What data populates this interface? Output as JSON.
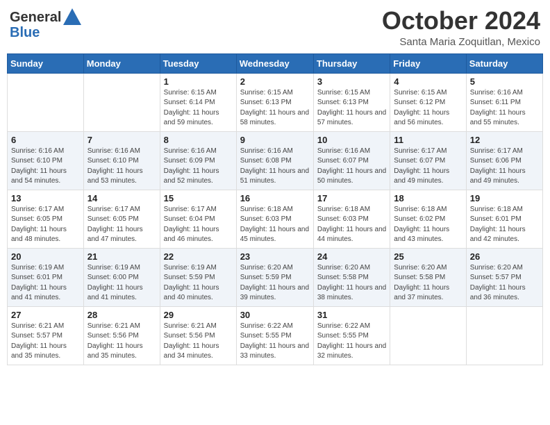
{
  "header": {
    "logo_general": "General",
    "logo_blue": "Blue",
    "month_title": "October 2024",
    "location": "Santa Maria Zoquitlan, Mexico"
  },
  "weekdays": [
    "Sunday",
    "Monday",
    "Tuesday",
    "Wednesday",
    "Thursday",
    "Friday",
    "Saturday"
  ],
  "weeks": [
    [
      {
        "day": "",
        "info": ""
      },
      {
        "day": "",
        "info": ""
      },
      {
        "day": "1",
        "info": "Sunrise: 6:15 AM\nSunset: 6:14 PM\nDaylight: 11 hours and 59 minutes."
      },
      {
        "day": "2",
        "info": "Sunrise: 6:15 AM\nSunset: 6:13 PM\nDaylight: 11 hours and 58 minutes."
      },
      {
        "day": "3",
        "info": "Sunrise: 6:15 AM\nSunset: 6:13 PM\nDaylight: 11 hours and 57 minutes."
      },
      {
        "day": "4",
        "info": "Sunrise: 6:15 AM\nSunset: 6:12 PM\nDaylight: 11 hours and 56 minutes."
      },
      {
        "day": "5",
        "info": "Sunrise: 6:16 AM\nSunset: 6:11 PM\nDaylight: 11 hours and 55 minutes."
      }
    ],
    [
      {
        "day": "6",
        "info": "Sunrise: 6:16 AM\nSunset: 6:10 PM\nDaylight: 11 hours and 54 minutes."
      },
      {
        "day": "7",
        "info": "Sunrise: 6:16 AM\nSunset: 6:10 PM\nDaylight: 11 hours and 53 minutes."
      },
      {
        "day": "8",
        "info": "Sunrise: 6:16 AM\nSunset: 6:09 PM\nDaylight: 11 hours and 52 minutes."
      },
      {
        "day": "9",
        "info": "Sunrise: 6:16 AM\nSunset: 6:08 PM\nDaylight: 11 hours and 51 minutes."
      },
      {
        "day": "10",
        "info": "Sunrise: 6:16 AM\nSunset: 6:07 PM\nDaylight: 11 hours and 50 minutes."
      },
      {
        "day": "11",
        "info": "Sunrise: 6:17 AM\nSunset: 6:07 PM\nDaylight: 11 hours and 49 minutes."
      },
      {
        "day": "12",
        "info": "Sunrise: 6:17 AM\nSunset: 6:06 PM\nDaylight: 11 hours and 49 minutes."
      }
    ],
    [
      {
        "day": "13",
        "info": "Sunrise: 6:17 AM\nSunset: 6:05 PM\nDaylight: 11 hours and 48 minutes."
      },
      {
        "day": "14",
        "info": "Sunrise: 6:17 AM\nSunset: 6:05 PM\nDaylight: 11 hours and 47 minutes."
      },
      {
        "day": "15",
        "info": "Sunrise: 6:17 AM\nSunset: 6:04 PM\nDaylight: 11 hours and 46 minutes."
      },
      {
        "day": "16",
        "info": "Sunrise: 6:18 AM\nSunset: 6:03 PM\nDaylight: 11 hours and 45 minutes."
      },
      {
        "day": "17",
        "info": "Sunrise: 6:18 AM\nSunset: 6:03 PM\nDaylight: 11 hours and 44 minutes."
      },
      {
        "day": "18",
        "info": "Sunrise: 6:18 AM\nSunset: 6:02 PM\nDaylight: 11 hours and 43 minutes."
      },
      {
        "day": "19",
        "info": "Sunrise: 6:18 AM\nSunset: 6:01 PM\nDaylight: 11 hours and 42 minutes."
      }
    ],
    [
      {
        "day": "20",
        "info": "Sunrise: 6:19 AM\nSunset: 6:01 PM\nDaylight: 11 hours and 41 minutes."
      },
      {
        "day": "21",
        "info": "Sunrise: 6:19 AM\nSunset: 6:00 PM\nDaylight: 11 hours and 41 minutes."
      },
      {
        "day": "22",
        "info": "Sunrise: 6:19 AM\nSunset: 5:59 PM\nDaylight: 11 hours and 40 minutes."
      },
      {
        "day": "23",
        "info": "Sunrise: 6:20 AM\nSunset: 5:59 PM\nDaylight: 11 hours and 39 minutes."
      },
      {
        "day": "24",
        "info": "Sunrise: 6:20 AM\nSunset: 5:58 PM\nDaylight: 11 hours and 38 minutes."
      },
      {
        "day": "25",
        "info": "Sunrise: 6:20 AM\nSunset: 5:58 PM\nDaylight: 11 hours and 37 minutes."
      },
      {
        "day": "26",
        "info": "Sunrise: 6:20 AM\nSunset: 5:57 PM\nDaylight: 11 hours and 36 minutes."
      }
    ],
    [
      {
        "day": "27",
        "info": "Sunrise: 6:21 AM\nSunset: 5:57 PM\nDaylight: 11 hours and 35 minutes."
      },
      {
        "day": "28",
        "info": "Sunrise: 6:21 AM\nSunset: 5:56 PM\nDaylight: 11 hours and 35 minutes."
      },
      {
        "day": "29",
        "info": "Sunrise: 6:21 AM\nSunset: 5:56 PM\nDaylight: 11 hours and 34 minutes."
      },
      {
        "day": "30",
        "info": "Sunrise: 6:22 AM\nSunset: 5:55 PM\nDaylight: 11 hours and 33 minutes."
      },
      {
        "day": "31",
        "info": "Sunrise: 6:22 AM\nSunset: 5:55 PM\nDaylight: 11 hours and 32 minutes."
      },
      {
        "day": "",
        "info": ""
      },
      {
        "day": "",
        "info": ""
      }
    ]
  ]
}
